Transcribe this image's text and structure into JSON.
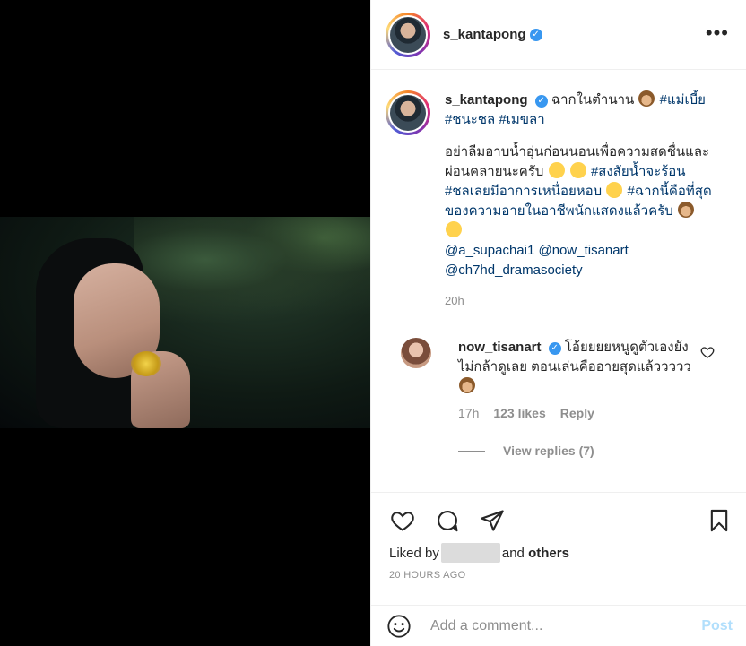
{
  "header": {
    "username": "s_kantapong",
    "more_icon": "more-horizontal-icon"
  },
  "caption": {
    "username": "s_kantapong",
    "line1": "ฉากในตำนาน",
    "tags1": [
      "#แม่เบี้ย",
      "#ชนะชล",
      "#เมขลา"
    ],
    "para1": "อย่าลืมอาบน้ำอุ่นก่อนนอนเพื่อความสดชื่นและผ่อนคลายนะครับ",
    "tag_a": "#สงสัยน้ำจะร้อน",
    "tag_b": "#ชลเลยมีอาการเหนื่อยหอบ",
    "tag_c": "#ฉากนี้คือที่สุดของความอายในอาชีพนักแสดงแล้วครับ",
    "mention1": "@a_supachai1",
    "mention2": "@now_tisanart",
    "mention3": "@ch7hd_dramasociety",
    "time": "20h"
  },
  "reply": {
    "username": "now_tisanart",
    "text": "โอ้ยยยยหนูดูตัวเองยังไม่กล้าดูเลย ตอนเล่นคืออายสุดแล้ววววว",
    "time": "17h",
    "likes": "123 likes",
    "reply_label": "Reply",
    "view_replies": "View replies (7)"
  },
  "actions": {
    "liked_by_prefix": "Liked by",
    "liked_by_suffix": "and",
    "others": "others",
    "timestamp": "20 HOURS AGO"
  },
  "comment_box": {
    "placeholder": "Add a comment...",
    "post_label": "Post"
  },
  "colors": {
    "link": "#00376b",
    "verified": "#3897f0",
    "post_disabled": "#b2dffc",
    "muted": "#8e8e8e"
  }
}
